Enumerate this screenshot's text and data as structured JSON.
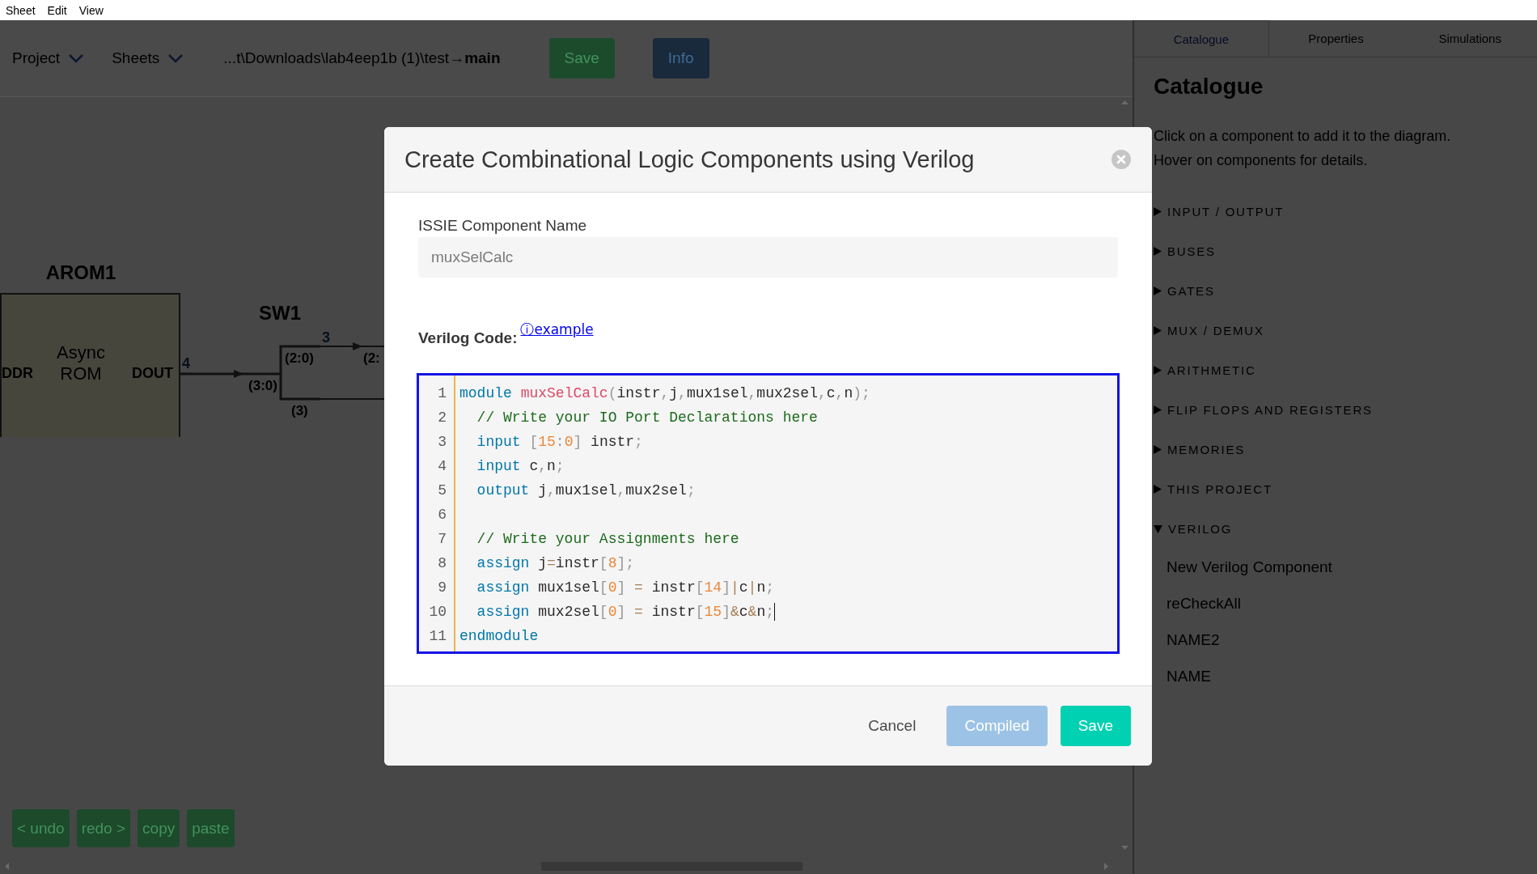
{
  "menu_bar": {
    "items": [
      "Sheet",
      "Edit",
      "View"
    ]
  },
  "toolbar": {
    "menus": [
      "Project",
      "Sheets"
    ],
    "path": "...t\\Downloads\\lab4eep1b (1)\\test→**main**",
    "buttons": [
      {
        "label": "Save",
        "kind": "success"
      },
      {
        "label": "Info",
        "kind": "info"
      }
    ]
  },
  "diagram": {
    "components": [
      {
        "kind": "rom",
        "name": "AROM1",
        "title_lines": [
          "Async",
          "ROM"
        ],
        "ports": [
          "DDR",
          "DOUT"
        ]
      },
      {
        "kind": "splitter",
        "name": "SW1",
        "ports": [
          "(3:0)",
          "(2:0)",
          "(3)"
        ]
      },
      {
        "kind": "partial",
        "ports": [
          "(2:"
        ]
      }
    ],
    "wires": [
      {
        "label": "4"
      },
      {
        "label": "3"
      }
    ]
  },
  "edit_buttons": [
    "< undo",
    "redo >",
    "copy",
    "paste"
  ],
  "side_panel": {
    "tabs": [
      {
        "label": "Catalogue",
        "selected": true
      },
      {
        "label": "Properties",
        "selected": false
      },
      {
        "label": "Simulations",
        "selected": false
      }
    ],
    "title": "Catalogue",
    "description": [
      "Click on a component to add it to the diagram.",
      "Hover on components for details."
    ],
    "categories": [
      {
        "label": "INPUT / OUTPUT",
        "expanded": false
      },
      {
        "label": "BUSES",
        "expanded": false
      },
      {
        "label": "GATES",
        "expanded": false
      },
      {
        "label": "MUX / DEMUX",
        "expanded": false
      },
      {
        "label": "ARITHMETIC",
        "expanded": false
      },
      {
        "label": "FLIP FLOPS AND REGISTERS",
        "expanded": false
      },
      {
        "label": "MEMORIES",
        "expanded": false
      },
      {
        "label": "THIS PROJECT",
        "expanded": false
      },
      {
        "label": "VERILOG",
        "expanded": true,
        "children": [
          {
            "label": "New Verilog Component"
          },
          {
            "label": "reCheckAll"
          },
          {
            "label": "NAME2"
          },
          {
            "label": "NAME"
          }
        ]
      }
    ]
  },
  "dialog": {
    "title": "Create Combinational Logic Components using Verilog",
    "name_field": {
      "label": "ISSIE Component Name",
      "value": "muxSelCalc",
      "disabled": true
    },
    "code_label": "Verilog Code:",
    "example_link": "ⓘexample",
    "code_lines": [
      {
        "number": "1",
        "cursor": false,
        "tokens": [
          {
            "kind": "keyword",
            "text": "module "
          },
          {
            "kind": "function",
            "text": "muxSelCalc"
          },
          {
            "kind": "punctuation",
            "text": "("
          },
          {
            "kind": "plain",
            "text": "instr"
          },
          {
            "kind": "punctuation",
            "text": ","
          },
          {
            "kind": "plain",
            "text": "j"
          },
          {
            "kind": "punctuation",
            "text": ","
          },
          {
            "kind": "plain",
            "text": "mux1sel"
          },
          {
            "kind": "punctuation",
            "text": ","
          },
          {
            "kind": "plain",
            "text": "mux2sel"
          },
          {
            "kind": "punctuation",
            "text": ","
          },
          {
            "kind": "plain",
            "text": "c"
          },
          {
            "kind": "punctuation",
            "text": ","
          },
          {
            "kind": "plain",
            "text": "n"
          },
          {
            "kind": "punctuation",
            "text": ");"
          }
        ]
      },
      {
        "number": "2",
        "cursor": false,
        "tokens": [
          {
            "kind": "comment",
            "text": "  // Write your IO Port Declarations here"
          }
        ]
      },
      {
        "number": "3",
        "cursor": false,
        "tokens": [
          {
            "kind": "keyword",
            "text": "  input "
          },
          {
            "kind": "punctuation",
            "text": "["
          },
          {
            "kind": "number",
            "text": "15"
          },
          {
            "kind": "punctuation",
            "text": ":"
          },
          {
            "kind": "number",
            "text": "0"
          },
          {
            "kind": "punctuation",
            "text": "]"
          },
          {
            "kind": "plain",
            "text": " instr"
          },
          {
            "kind": "punctuation",
            "text": ";"
          }
        ]
      },
      {
        "number": "4",
        "cursor": false,
        "tokens": [
          {
            "kind": "keyword",
            "text": "  input"
          },
          {
            "kind": "plain",
            "text": " c"
          },
          {
            "kind": "punctuation",
            "text": ","
          },
          {
            "kind": "plain",
            "text": "n"
          },
          {
            "kind": "punctuation",
            "text": ";"
          }
        ]
      },
      {
        "number": "5",
        "cursor": false,
        "tokens": [
          {
            "kind": "keyword",
            "text": "  output"
          },
          {
            "kind": "plain",
            "text": " j"
          },
          {
            "kind": "punctuation",
            "text": ","
          },
          {
            "kind": "plain",
            "text": "mux1sel"
          },
          {
            "kind": "punctuation",
            "text": ","
          },
          {
            "kind": "plain",
            "text": "mux2sel"
          },
          {
            "kind": "punctuation",
            "text": ";"
          }
        ]
      },
      {
        "number": "6",
        "cursor": false
      },
      {
        "number": "7",
        "cursor": false,
        "tokens": [
          {
            "kind": "comment",
            "text": "  // Write your Assignments here"
          }
        ]
      },
      {
        "number": "8",
        "cursor": false,
        "tokens": [
          {
            "kind": "keyword",
            "text": "  assign"
          },
          {
            "kind": "plain",
            "text": " j"
          },
          {
            "kind": "operator",
            "text": "="
          },
          {
            "kind": "plain",
            "text": "instr"
          },
          {
            "kind": "punctuation",
            "text": "["
          },
          {
            "kind": "number",
            "text": "8"
          },
          {
            "kind": "punctuation",
            "text": "];"
          }
        ]
      },
      {
        "number": "9",
        "cursor": false,
        "tokens": [
          {
            "kind": "keyword",
            "text": "  assign"
          },
          {
            "kind": "plain",
            "text": " mux1sel"
          },
          {
            "kind": "punctuation",
            "text": "["
          },
          {
            "kind": "number",
            "text": "0"
          },
          {
            "kind": "punctuation",
            "text": "]"
          },
          {
            "kind": "operator",
            "text": " ="
          },
          {
            "kind": "plain",
            "text": " instr"
          },
          {
            "kind": "punctuation",
            "text": "["
          },
          {
            "kind": "number",
            "text": "14"
          },
          {
            "kind": "punctuation",
            "text": "]"
          },
          {
            "kind": "operator",
            "text": "|"
          },
          {
            "kind": "plain",
            "text": "c"
          },
          {
            "kind": "operator",
            "text": "|"
          },
          {
            "kind": "plain",
            "text": "n"
          },
          {
            "kind": "punctuation",
            "text": ";"
          }
        ]
      },
      {
        "number": "10",
        "cursor": true,
        "tokens": [
          {
            "kind": "keyword",
            "text": "  assign"
          },
          {
            "kind": "plain",
            "text": " mux2sel"
          },
          {
            "kind": "punctuation",
            "text": "["
          },
          {
            "kind": "number",
            "text": "0"
          },
          {
            "kind": "punctuation",
            "text": "]"
          },
          {
            "kind": "operator",
            "text": " ="
          },
          {
            "kind": "plain",
            "text": " instr"
          },
          {
            "kind": "punctuation",
            "text": "["
          },
          {
            "kind": "number",
            "text": "15"
          },
          {
            "kind": "punctuation",
            "text": "]"
          },
          {
            "kind": "operator",
            "text": "&"
          },
          {
            "kind": "plain",
            "text": "c"
          },
          {
            "kind": "operator",
            "text": "&"
          },
          {
            "kind": "plain",
            "text": "n"
          },
          {
            "kind": "punctuation",
            "text": ";"
          }
        ]
      },
      {
        "number": "11",
        "cursor": false,
        "tokens": [
          {
            "kind": "keyword",
            "text": "endmodule"
          }
        ]
      }
    ],
    "buttons": [
      {
        "label": "Cancel",
        "kind": "text",
        "disabled": false
      },
      {
        "label": "Compiled",
        "kind": "info",
        "disabled": true
      },
      {
        "label": "Save",
        "kind": "primary",
        "disabled": false
      }
    ]
  }
}
